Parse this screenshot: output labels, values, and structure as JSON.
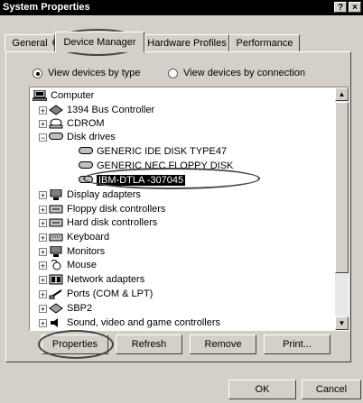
{
  "window": {
    "title": "System Properties",
    "help_label": "?",
    "close_label": "×"
  },
  "tabs": [
    {
      "label": "General"
    },
    {
      "label": "Device Manager"
    },
    {
      "label": "Hardware Profiles"
    },
    {
      "label": "Performance"
    }
  ],
  "view_options": {
    "by_type_label": "View devices by type",
    "by_connection_label": "View devices by connection",
    "selected": "by_type"
  },
  "tree": {
    "root": "Computer",
    "items": [
      {
        "label": "1394 Bus Controller",
        "icon": "bus-icon"
      },
      {
        "label": "CDROM",
        "icon": "cdrom-icon"
      },
      {
        "label": "Disk drives",
        "icon": "disk-drive-icon",
        "expanded": true,
        "children": [
          {
            "label": "GENERIC IDE  DISK TYPE47"
          },
          {
            "label": "GENERIC NEC  FLOPPY DISK"
          },
          {
            "label": "IBM-DTLA -307045",
            "selected": true
          }
        ]
      },
      {
        "label": "Display adapters",
        "icon": "monitor-icon"
      },
      {
        "label": "Floppy disk controllers",
        "icon": "controller-icon"
      },
      {
        "label": "Hard disk controllers",
        "icon": "controller-icon"
      },
      {
        "label": "Keyboard",
        "icon": "keyboard-icon"
      },
      {
        "label": "Monitors",
        "icon": "monitor-icon"
      },
      {
        "label": "Mouse",
        "icon": "mouse-icon"
      },
      {
        "label": "Network adapters",
        "icon": "network-icon"
      },
      {
        "label": "Ports (COM & LPT)",
        "icon": "port-icon"
      },
      {
        "label": "SBP2",
        "icon": "sbp2-icon"
      },
      {
        "label": "Sound, video and game controllers",
        "icon": "sound-icon"
      }
    ]
  },
  "buttons": {
    "properties": "Properties",
    "refresh": "Refresh",
    "remove": "Remove",
    "print": "Print...",
    "ok": "OK",
    "cancel": "Cancel"
  }
}
